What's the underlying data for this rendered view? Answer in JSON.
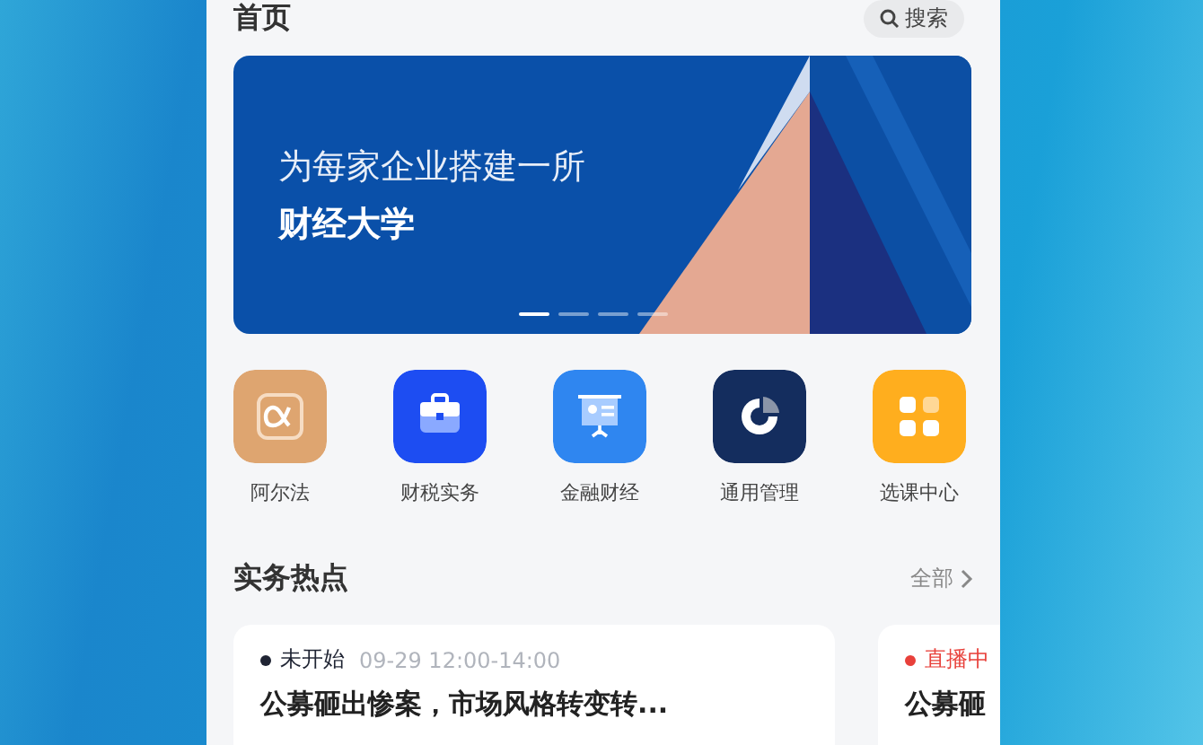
{
  "header": {
    "title": "首页",
    "search": {
      "label": "搜索"
    }
  },
  "banner": {
    "line1": "为每家企业搭建一所",
    "line2": "财经大学",
    "dots": [
      {
        "selected": true
      },
      {
        "selected": false
      },
      {
        "selected": false
      },
      {
        "selected": false
      }
    ]
  },
  "categories": [
    {
      "label": "阿尔法"
    },
    {
      "label": "财税实务"
    },
    {
      "label": "金融财经"
    },
    {
      "label": "通用管理"
    },
    {
      "label": "选课中心"
    }
  ],
  "section": {
    "title": "实务热点",
    "more": "全部"
  },
  "cards": [
    {
      "status": "未开始",
      "color": "#1f2433",
      "time": "09-29 12:00-14:00",
      "title": "公募砸出惨案，市场风格转变转..."
    },
    {
      "status": "直播中",
      "color": "#e8403a",
      "title": "公募砸"
    }
  ]
}
